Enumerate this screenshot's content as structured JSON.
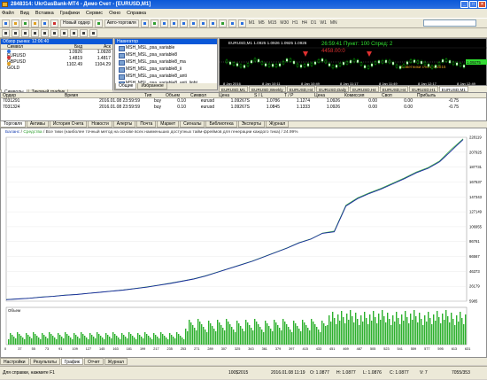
{
  "window": {
    "title": "2848314: UkrGasBank-MT4 - Демо Счет - [EURUSD,M1]"
  },
  "menu": [
    "Файл",
    "Вид",
    "Вставка",
    "Графики",
    "Сервис",
    "Окно",
    "Справка"
  ],
  "toolbar": {
    "new_order": "Новый ордер",
    "autotrading": "Авто-торговля",
    "timeframes": [
      "M1",
      "M5",
      "M15",
      "M30",
      "H1",
      "H4",
      "D1",
      "W1",
      "MN"
    ]
  },
  "market_watch": {
    "title": "Обзор рынка: 12:06:40",
    "columns": [
      "Символ",
      "Бид",
      "Аск"
    ],
    "rows": [
      {
        "symbol": "EURUSD",
        "bid": "1.0926",
        "ask": "1.0928",
        "color": "#2a6fe0"
      },
      {
        "symbol": "GBPUSD",
        "bid": "1.4819",
        "ask": "1.4817",
        "color": "#d03030"
      },
      {
        "symbol": "GOLD",
        "bid": "1102.49",
        "ask": "1104.29",
        "color": "#e0a020"
      }
    ],
    "tabs": [
      "Символы",
      "Тиковый график"
    ]
  },
  "navigator": {
    "title": "Навигатор",
    "items": [
      "MSH_MSL_psa_variable",
      "MSH_MSL_psa_variable8",
      "MSH_MSL_psa_variable8_ma",
      "MSH_MSL_psa_variable8_ii",
      "MSH_MSL_psa_variable8_anti",
      "MSH_MSL_psa_variable8_anti_light"
    ],
    "tabs": [
      "Общие",
      "Избранное"
    ]
  },
  "chart": {
    "header": "EURUSD,M1  1.0925 1.0926 1.0925 1.0926",
    "overlay": "26:59:41 Пункт: 100 Спред: 2",
    "overlay2": "4458.00:0",
    "price_right": "1.09275",
    "copyright": "Советники счета с 2015",
    "tabs": [
      "EURUSD,M1",
      "EURUSD,Weekly",
      "EURUSD,H4",
      "EURUSD,Daily",
      "EURUSD,H4",
      "EURUSD,H4",
      "EURUSD,H1",
      "EURUSD,M1"
    ],
    "time_labels": [
      "8 Jan 2016",
      "8 Jan 10:11",
      "8 Jan 10:49",
      "8 Jan 11:17",
      "8 Jan 11:49",
      "8 Jan 12:17",
      "8 Jan 12:49"
    ]
  },
  "terminal": {
    "columns": [
      "Ордер",
      "Время",
      "Тип",
      "Объем",
      "Символ",
      "Цена",
      "S / L",
      "T / P",
      "Цена",
      "Комиссия",
      "Своп",
      "Прибыль"
    ],
    "rows": [
      {
        "order": "7031291",
        "time": "2016.01.08 23:59:59",
        "type": "buy",
        "volume": "0.10",
        "symbol": "eurusd",
        "price": "1.09267S",
        "sl": "1.0786",
        "tp": "1.1274",
        "cur": "1.0926",
        "comm": "0.00",
        "swap": "0.00",
        "profit": "-0.75"
      },
      {
        "order": "7031324",
        "time": "2016.01.08 23:59:59",
        "type": "buy",
        "volume": "0.10",
        "symbol": "eurusd",
        "price": "1.09267S",
        "sl": "1.0845",
        "tp": "1.1333",
        "cur": "1.0926",
        "comm": "0.00",
        "swap": "0.00",
        "profit": "-0.75"
      }
    ],
    "tabs": [
      "Торговля",
      "Активы",
      "История Счета",
      "Новости",
      "Алерты",
      "Почта",
      "Маркет",
      "Сигналы",
      "Библиотека",
      "Эксперты",
      "Журнал"
    ]
  },
  "tester": {
    "title_parts": [
      "Баланс",
      "Средства",
      "Все тики (наиболее точный метод на основе всех наименьших доступных тайм-фреймов для генерации каждого тика) / 24.99%"
    ],
    "colors": {
      "balance": "#1a2aa0",
      "equity": "#3cb043"
    },
    "y_labels": [
      "228119",
      "207925",
      "187731",
      "167537",
      "147343",
      "127149",
      "106955",
      "86761",
      "66567",
      "46373",
      "26179",
      "5985"
    ],
    "volume_label": "Объем",
    "x_labels": [
      "0",
      "37",
      "55",
      "73",
      "91",
      "109",
      "127",
      "145",
      "163",
      "181",
      "199",
      "217",
      "235",
      "253",
      "271",
      "289",
      "307",
      "325",
      "343",
      "361",
      "379",
      "397",
      "415",
      "433",
      "451",
      "469",
      "487",
      "505",
      "523",
      "541",
      "559",
      "577",
      "595",
      "613",
      "631"
    ],
    "tabs": [
      "Настройки",
      "Результаты",
      "График",
      "Отчет",
      "Журнал"
    ]
  },
  "chart_data": {
    "type": "line",
    "ylim": [
      5985,
      228119
    ],
    "series": [
      {
        "name": "Баланс",
        "values": [
          8000,
          9000,
          10000,
          11500,
          12500,
          14000,
          15000,
          16500,
          18000,
          19500,
          21000,
          23000,
          25000,
          27500,
          30000,
          33000,
          36000,
          40000,
          45000,
          50000,
          55000,
          60000,
          66000,
          72000,
          78000,
          85000,
          90000,
          98000,
          100000,
          135000,
          145000,
          152000,
          158000,
          165000,
          172000,
          180000,
          186000,
          195000,
          210000,
          225000
        ]
      },
      {
        "name": "Средства",
        "values": [
          8200,
          9100,
          10100,
          11600,
          12600,
          14200,
          15100,
          16700,
          18100,
          19700,
          21200,
          23200,
          25300,
          27700,
          30300,
          33200,
          36300,
          40300,
          45300,
          50300,
          55300,
          60300,
          66300,
          72400,
          78300,
          85300,
          90300,
          98300,
          101000,
          136000,
          146000,
          153000,
          159000,
          166000,
          173000,
          181000,
          187000,
          196000,
          212000,
          226000
        ]
      }
    ]
  },
  "status": {
    "help": "Для справки, нажмите F1",
    "profile": "100$2015",
    "datetime": "2016.01.08 11:19",
    "open": "O: 1.0877",
    "high": "H: 1.0877",
    "low": "L: 1.0876",
    "close": "C: 1.0877",
    "volume": "V: 7",
    "traffic": "7055/353"
  }
}
